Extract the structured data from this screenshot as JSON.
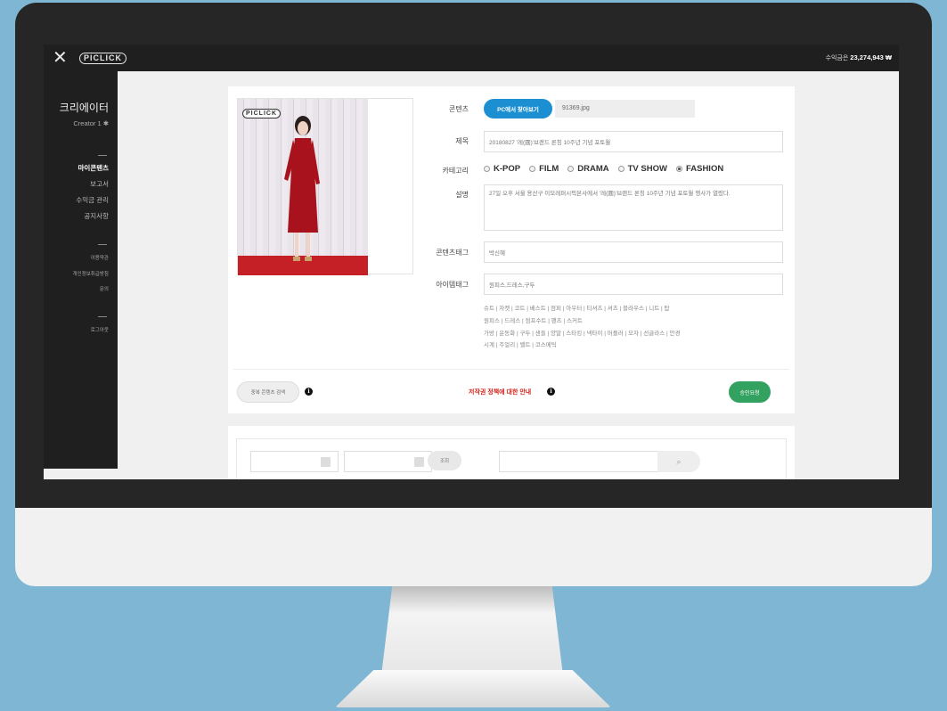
{
  "app": {
    "logo_text": "PICLICK",
    "close_glyph": "✕",
    "earnings_label": "수익금은",
    "earnings_value": "23,274,943 ₩"
  },
  "sidebar": {
    "title": "크리에이터",
    "creator": "Creator 1 ✱",
    "menu": [
      {
        "label": "마이콘텐츠",
        "active": true
      },
      {
        "label": "보고서"
      },
      {
        "label": "수익금 관리"
      },
      {
        "label": "공지사항"
      }
    ],
    "small_links": [
      "이용약관",
      "개인정보취급방침",
      "문의"
    ],
    "logout": "로그아웃"
  },
  "form": {
    "photo_logo": "PICLICK",
    "content_label": "콘텐츠",
    "file_button": "PC에서 찾아보기",
    "file_name": "91369.jpg",
    "title_label": "제목",
    "title_value": "20180827 '레(圓)'브랜드 론칭 10주년 기념 포토월",
    "category_label": "카테고리",
    "categories": [
      {
        "label": "K-POP",
        "checked": false
      },
      {
        "label": "FILM",
        "checked": false
      },
      {
        "label": "DRAMA",
        "checked": false
      },
      {
        "label": "TV SHOW",
        "checked": false
      },
      {
        "label": "FASHION",
        "checked": true
      }
    ],
    "desc_label": "설명",
    "desc_value": "27일 오후 서울 용산구 이모레퍼시픽본사에서 '레(圓)'브랜드 론칭 10주년 기념 포토월 행사가 열렸다.",
    "content_tag_label": "콘텐츠태그",
    "content_tag_value": "박신혜",
    "item_tag_label": "아이템태그",
    "item_tag_value": "원피스,드레스,구두",
    "tag_suggestions": [
      "슈트 | 자켓 | 코트 | 베스트 | 점퍼 | 아우터 | 티셔츠 | 셔츠 | 블라우스 | 니트 | 탑",
      "원피스 | 드레스 | 점프수트 | 팬츠 | 스커트",
      "가방 | 운동화 | 구두 | 샌들 | 양말 | 스타킹 | 넥타이 | 머플러 | 모자 | 선글라스 | 안경",
      "시계 | 주얼리 | 벨트 | 코스메틱"
    ],
    "dup_button": "중복 콘텐츠 검색",
    "copyright_notice": "저작권 정책에 대한 안내",
    "approve_button": "승인요청",
    "info_glyph": "i"
  },
  "filter": {
    "query_button": "조회",
    "search_glyph": "⌕"
  },
  "colors": {
    "accent_blue": "#1b8fd1",
    "approve_green": "#33a260",
    "warning_red": "#d6231c"
  }
}
